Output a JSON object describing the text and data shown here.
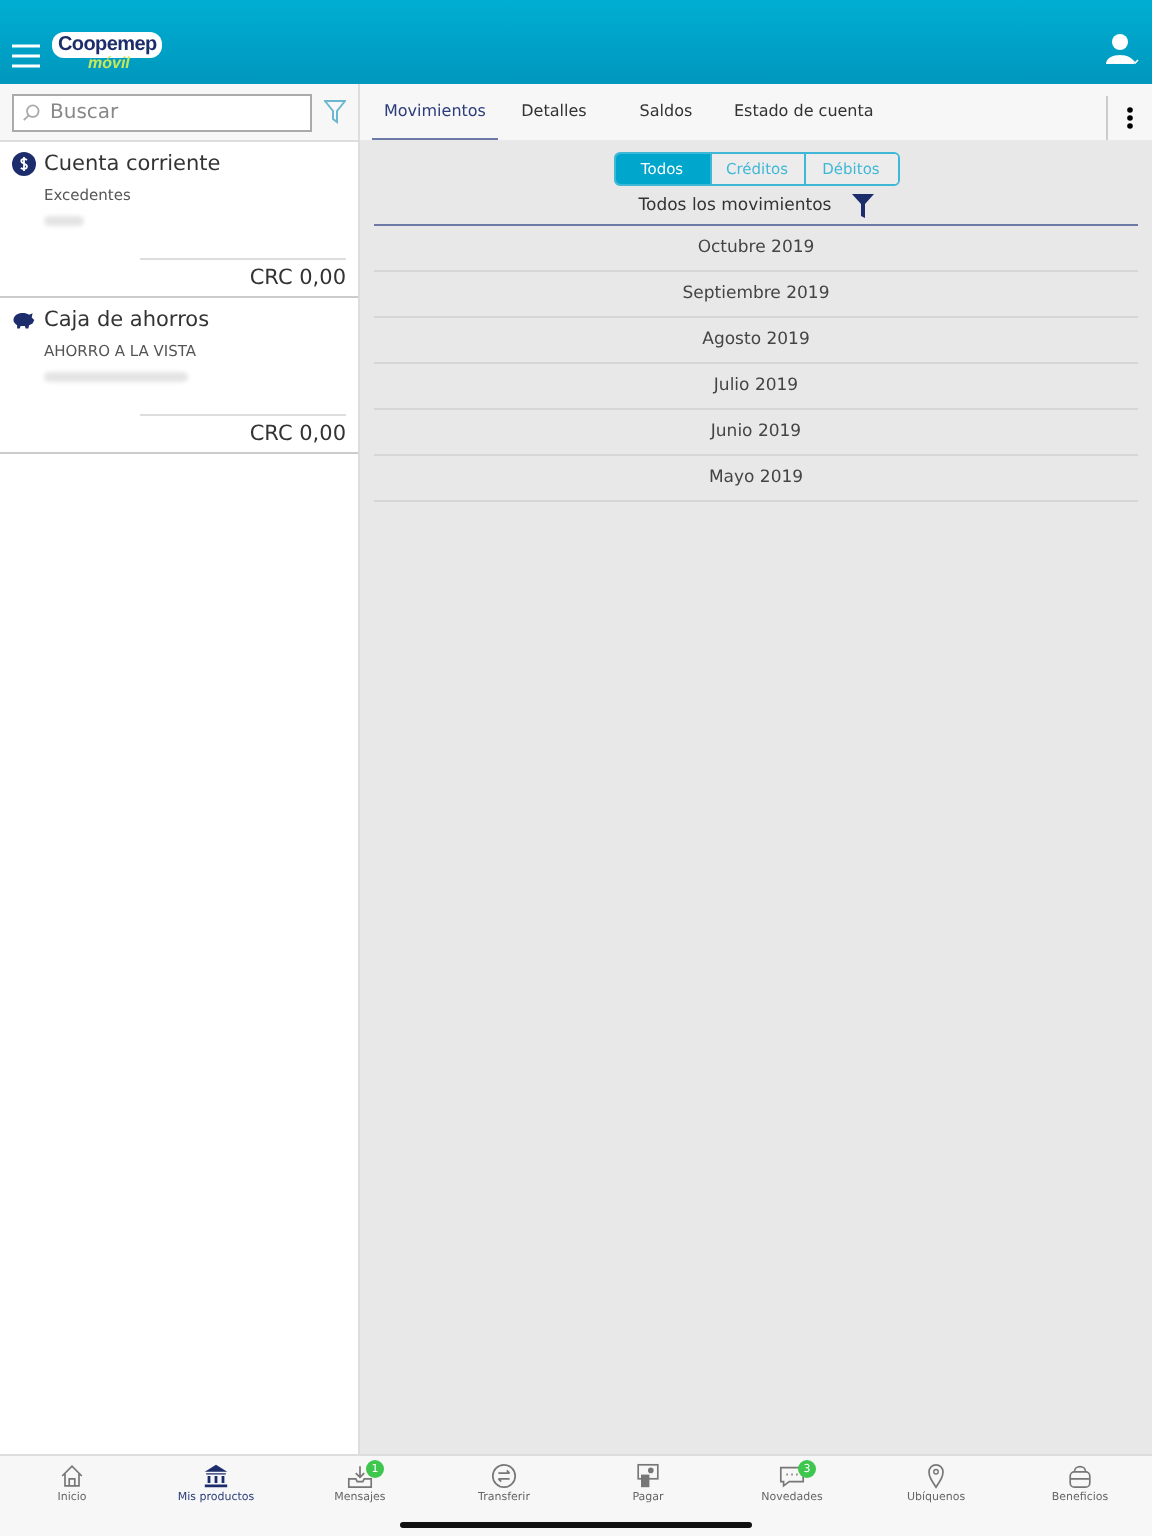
{
  "header": {
    "logo_top": "Coopemep",
    "logo_bottom": "móvil"
  },
  "sidebar": {
    "search": {
      "placeholder": "Buscar"
    },
    "products": [
      {
        "name": "Cuenta corriente",
        "subtitle": "Excedentes",
        "balance": "CRC 0,00"
      },
      {
        "name": "Caja de ahorros",
        "subtitle": "AHORRO A LA VISTA",
        "balance": "CRC 0,00"
      }
    ]
  },
  "tabs": [
    {
      "label": "Movimientos",
      "selected": true
    },
    {
      "label": "Detalles",
      "selected": false
    },
    {
      "label": "Saldos",
      "selected": false
    },
    {
      "label": "Estado de cuenta",
      "selected": false
    }
  ],
  "segments": [
    {
      "label": "Todos",
      "selected": true
    },
    {
      "label": "Créditos",
      "selected": false
    },
    {
      "label": "Débitos",
      "selected": false
    }
  ],
  "filter_title": "Todos los movimientos",
  "months": [
    "Octubre 2019",
    "Septiembre 2019",
    "Agosto 2019",
    "Julio 2019",
    "Junio 2019",
    "Mayo 2019"
  ],
  "nav": [
    {
      "label": "Inicio",
      "selected": false
    },
    {
      "label": "Mis productos",
      "selected": true
    },
    {
      "label": "Mensajes",
      "selected": false,
      "badge": "1"
    },
    {
      "label": "Transferir",
      "selected": false
    },
    {
      "label": "Pagar",
      "selected": false
    },
    {
      "label": "Novedades",
      "selected": false,
      "badge": "3"
    },
    {
      "label": "Ubíquenos",
      "selected": false
    },
    {
      "label": "Beneficios",
      "selected": false
    }
  ]
}
